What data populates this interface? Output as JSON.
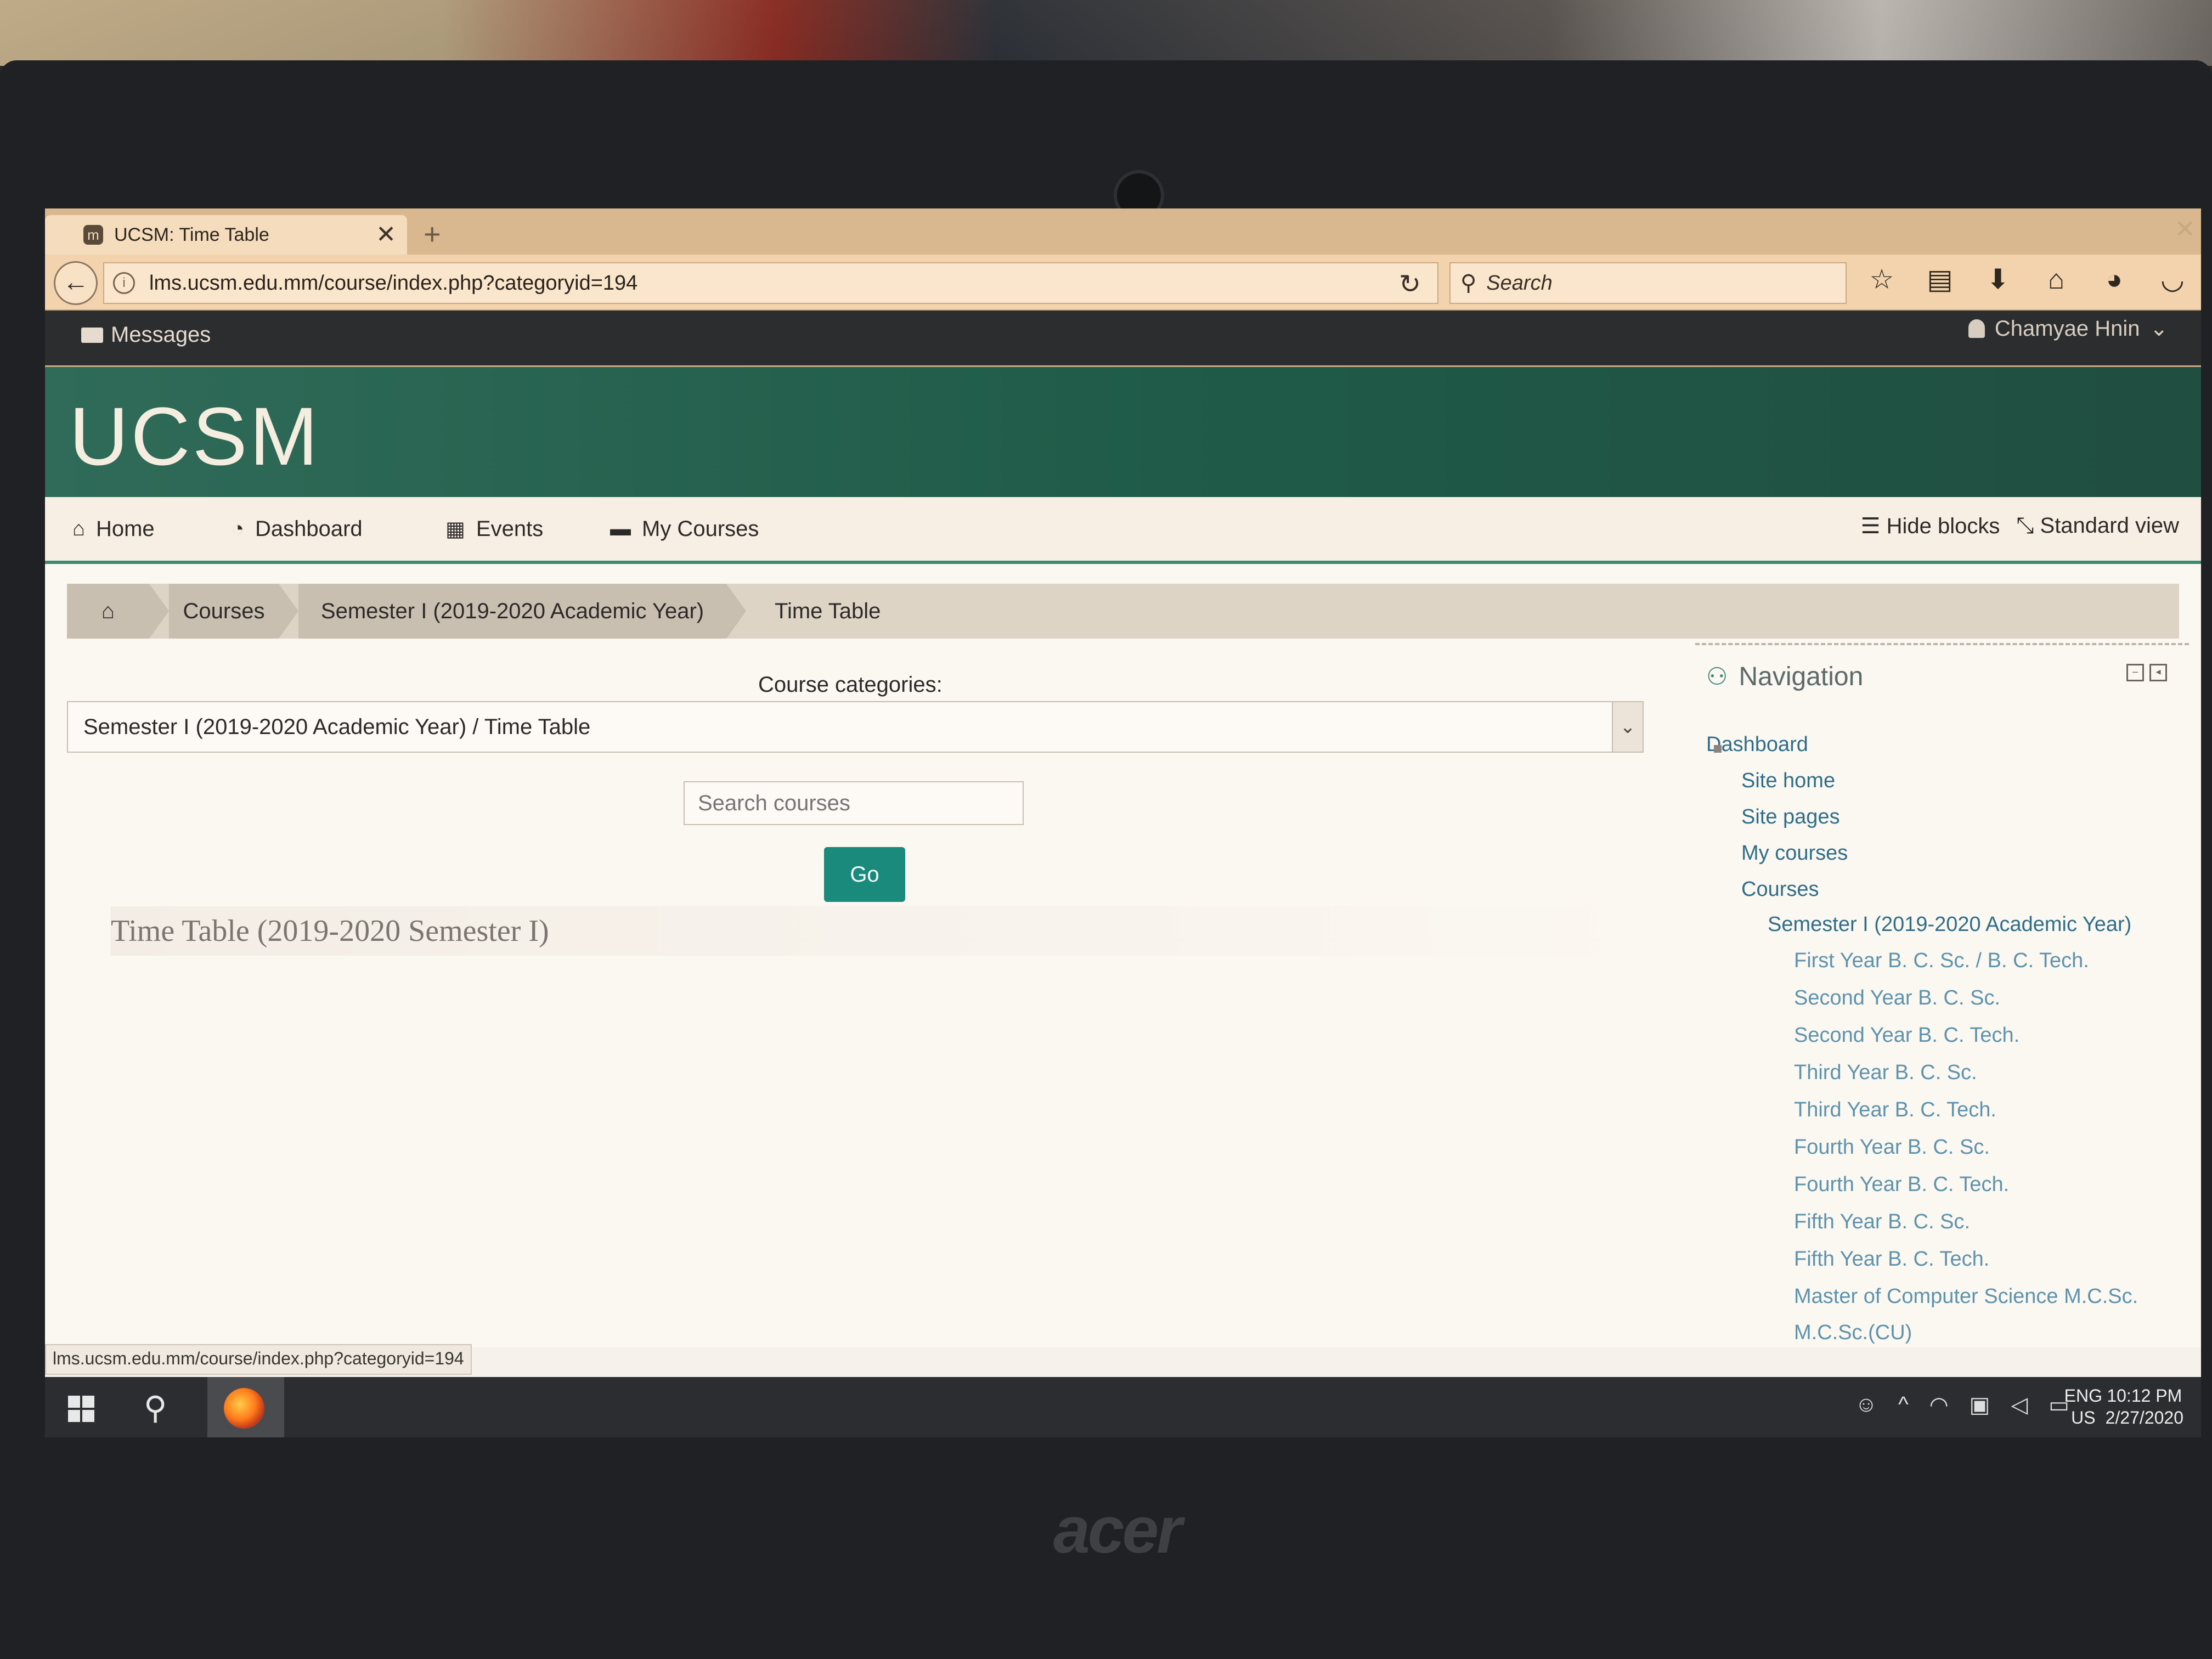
{
  "browser": {
    "tab_title": "UCSM: Time Table",
    "tab_close": "✕",
    "new_tab": "+",
    "url": "lms.ucsm.edu.mm/course/index.php?categoryid=194",
    "search_placeholder": "Search",
    "status_url": "lms.ucsm.edu.mm/course/index.php?categoryid=194"
  },
  "topbar": {
    "messages_label": "Messages",
    "user_name": "Chamyae Hnin"
  },
  "header": {
    "brand": "UCSM"
  },
  "mainnav": {
    "home": "Home",
    "dashboard": "Dashboard",
    "events": "Events",
    "my_courses": "My Courses",
    "hide_blocks": "Hide blocks",
    "standard_view": "Standard view"
  },
  "breadcrumb": {
    "courses": "Courses",
    "semester": "Semester I (2019-2020 Academic Year)",
    "current": "Time Table"
  },
  "main": {
    "categories_label": "Course categories:",
    "selected_category": "Semester I (2019-2020 Academic Year) / Time Table",
    "search_placeholder": "Search courses",
    "go_label": "Go",
    "course_heading": "Time Table (2019-2020 Semester I)"
  },
  "navigation_block": {
    "title": "Navigation",
    "items": [
      {
        "label": "Dashboard"
      },
      {
        "label": "Site home"
      },
      {
        "label": "Site pages"
      },
      {
        "label": "My courses"
      },
      {
        "label": "Courses"
      },
      {
        "label": "Semester I (2019-2020 Academic Year)"
      },
      {
        "label": "First Year B. C. Sc. / B. C. Tech."
      },
      {
        "label": "Second Year B. C. Sc."
      },
      {
        "label": "Second Year B. C. Tech."
      },
      {
        "label": "Third Year B. C. Sc."
      },
      {
        "label": "Third Year B. C. Tech."
      },
      {
        "label": "Fourth Year B. C. Sc."
      },
      {
        "label": "Fourth Year B. C. Tech."
      },
      {
        "label": "Fifth Year B. C. Sc."
      },
      {
        "label": "Fifth Year B. C. Tech."
      },
      {
        "label": "Master of Computer Science M.C.Sc."
      },
      {
        "label": "M.C.Sc.(CU)"
      }
    ]
  },
  "taskbar": {
    "lang_top": "ENG",
    "lang_bottom": "US",
    "time": "10:12 PM",
    "date": "2/27/2020"
  },
  "laptop": {
    "logo": "acer"
  },
  "colors": {
    "header_green": "#1f5a48",
    "accent_teal": "#1a8a7c",
    "nav_link": "#2f6e8a"
  }
}
